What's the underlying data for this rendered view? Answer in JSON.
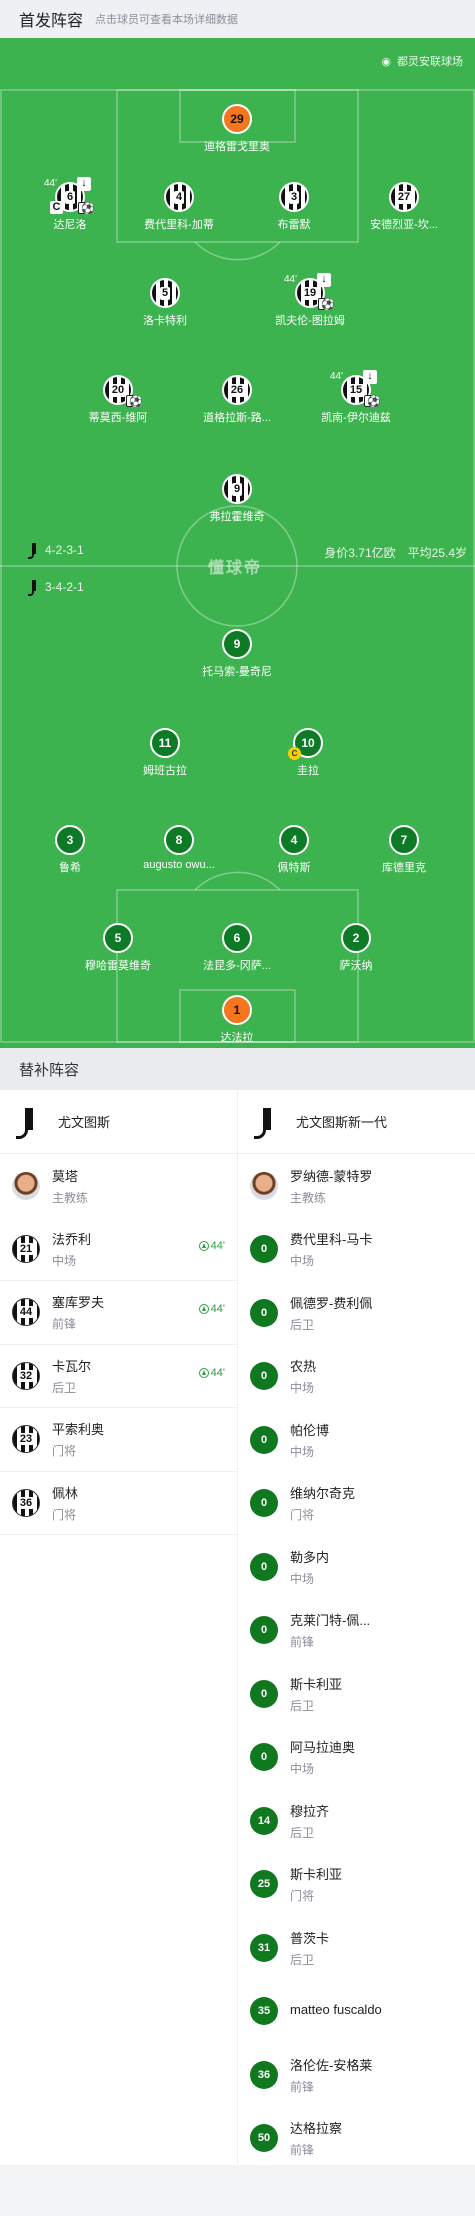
{
  "header": {
    "title": "首发阵容",
    "hint": "点击球员可查看本场详细数据"
  },
  "venue": "都灵安联球场",
  "watermark": "懂球帝",
  "colors": {
    "pitch": "#3db34f",
    "away_badge": "#0d7a25",
    "gk_home": "#f4761d",
    "sub_in": "#2e9e43"
  },
  "formations": {
    "top": "4-2-3-1",
    "bottom": "3-4-2-1"
  },
  "team_value": {
    "value": "身价3.71亿欧",
    "age": "平均25.4岁"
  },
  "home_players": [
    {
      "num": "29",
      "name": "迪格雷戈里奥",
      "gk": true
    },
    {
      "num": "6",
      "name": "达尼洛",
      "sub": "44'",
      "captain": true,
      "ball": true
    },
    {
      "num": "4",
      "name": "费代里科-加蒂"
    },
    {
      "num": "3",
      "name": "布雷默"
    },
    {
      "num": "27",
      "name": "安德烈亚-坎..."
    },
    {
      "num": "5",
      "name": "洛卡特利"
    },
    {
      "num": "19",
      "name": "凯夫伦-图拉姆",
      "sub": "44'",
      "ball": true
    },
    {
      "num": "20",
      "name": "蒂莫西-维阿",
      "ball": true
    },
    {
      "num": "26",
      "name": "道格拉斯-路..."
    },
    {
      "num": "15",
      "name": "凯南-伊尔迪兹",
      "sub": "44'",
      "ball": true
    },
    {
      "num": "9",
      "name": "弗拉霍维奇"
    }
  ],
  "away_players": [
    {
      "num": "9",
      "name": "托马索-曼奇尼"
    },
    {
      "num": "11",
      "name": "姆班古拉"
    },
    {
      "num": "10",
      "name": "圭拉",
      "captain": true
    },
    {
      "num": "3",
      "name": "鲁希"
    },
    {
      "num": "8",
      "name": "augusto owu..."
    },
    {
      "num": "4",
      "name": "佩特斯"
    },
    {
      "num": "7",
      "name": "库德里克"
    },
    {
      "num": "5",
      "name": "穆哈雷莫维奇"
    },
    {
      "num": "6",
      "name": "法昆多-冈萨..."
    },
    {
      "num": "2",
      "name": "萨沃纳"
    },
    {
      "num": "1",
      "name": "达法拉",
      "gk": true
    }
  ],
  "subs_title": "替补阵容",
  "home_subs": {
    "team": "尤文图斯",
    "coach": {
      "name": "莫塔",
      "role": "主教练"
    },
    "players": [
      {
        "num": "21",
        "name": "法乔利",
        "pos": "中场",
        "in": "44'"
      },
      {
        "num": "44",
        "name": "塞库罗夫",
        "pos": "前锋",
        "in": "44'"
      },
      {
        "num": "32",
        "name": "卡瓦尔",
        "pos": "后卫",
        "in": "44'"
      },
      {
        "num": "23",
        "name": "平索利奥",
        "pos": "门将"
      },
      {
        "num": "36",
        "name": "佩林",
        "pos": "门将"
      }
    ]
  },
  "away_subs": {
    "team": "尤文图斯新一代",
    "coach": {
      "name": "罗纳德-蒙特罗",
      "role": "主教练"
    },
    "players": [
      {
        "num": "0",
        "name": "费代里科-马卡",
        "pos": "中场"
      },
      {
        "num": "0",
        "name": "佩德罗-费利佩",
        "pos": "后卫"
      },
      {
        "num": "0",
        "name": "农热",
        "pos": "中场"
      },
      {
        "num": "0",
        "name": "帕伦博",
        "pos": "中场"
      },
      {
        "num": "0",
        "name": "维纳尔奇克",
        "pos": "门将"
      },
      {
        "num": "0",
        "name": "勒多内",
        "pos": "中场"
      },
      {
        "num": "0",
        "name": "克莱门特-佩...",
        "pos": "前锋"
      },
      {
        "num": "0",
        "name": "斯卡利亚",
        "pos": "后卫"
      },
      {
        "num": "0",
        "name": "阿马拉迪奥",
        "pos": "中场"
      },
      {
        "num": "14",
        "name": "穆拉齐",
        "pos": "后卫"
      },
      {
        "num": "25",
        "name": "斯卡利亚",
        "pos": "门将"
      },
      {
        "num": "31",
        "name": "普茨卡",
        "pos": "后卫"
      },
      {
        "num": "35",
        "name": "matteo fuscaldo",
        "pos": ""
      },
      {
        "num": "36",
        "name": "洛伦佐-安格莱",
        "pos": "前锋"
      },
      {
        "num": "50",
        "name": "达格拉察",
        "pos": "前锋"
      }
    ]
  }
}
